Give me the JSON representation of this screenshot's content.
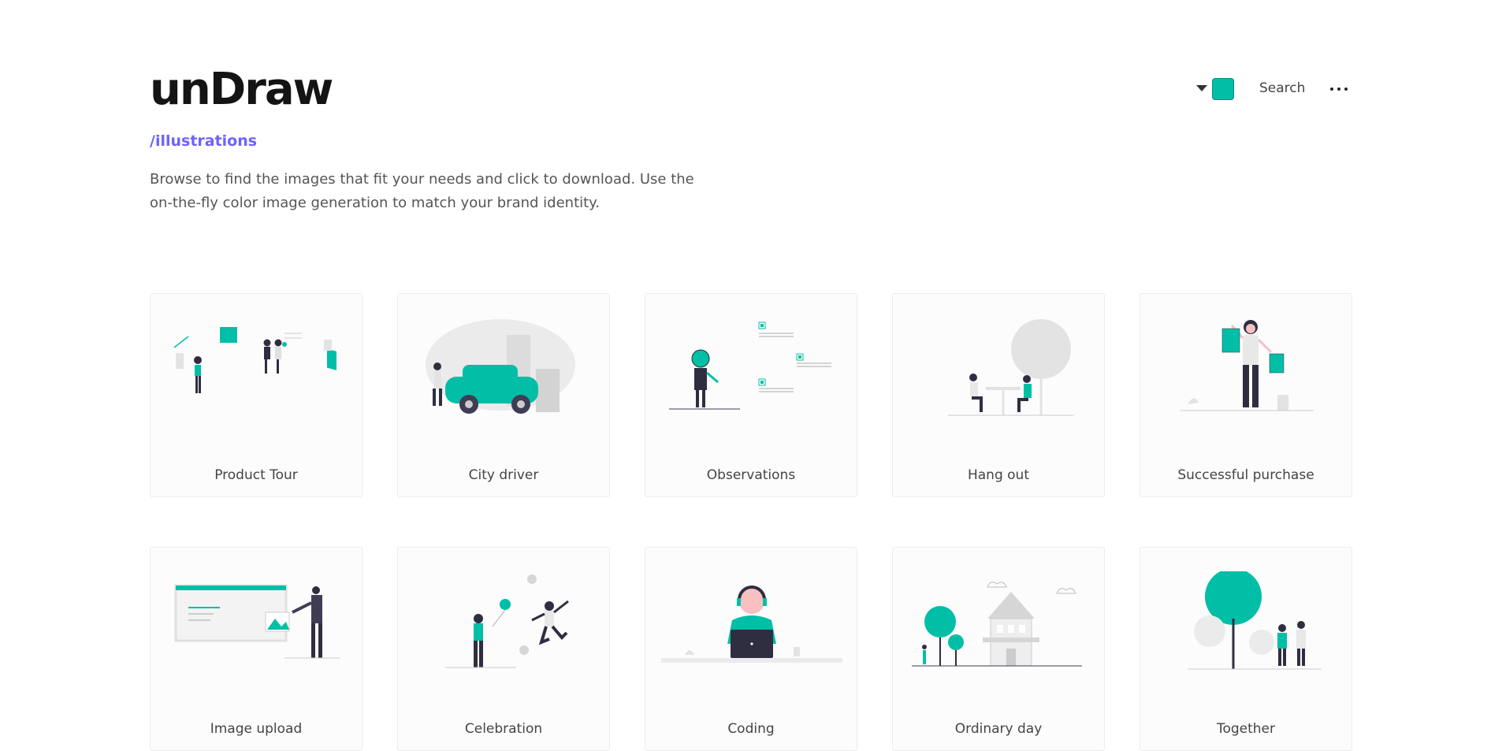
{
  "header": {
    "brand": "unDraw",
    "section_link": "/illustrations",
    "intro": "Browse to find the images that fit your needs and click to download. Use the on-the-fly color image generation to match your brand identity.",
    "search_label": "Search",
    "accent_color": "#00bfa6"
  },
  "illustrations": [
    {
      "title": "Product Tour"
    },
    {
      "title": "City driver"
    },
    {
      "title": "Observations"
    },
    {
      "title": "Hang out"
    },
    {
      "title": "Successful purchase"
    },
    {
      "title": "Image upload"
    },
    {
      "title": "Celebration"
    },
    {
      "title": "Coding"
    },
    {
      "title": "Ordinary day"
    },
    {
      "title": "Together"
    }
  ]
}
